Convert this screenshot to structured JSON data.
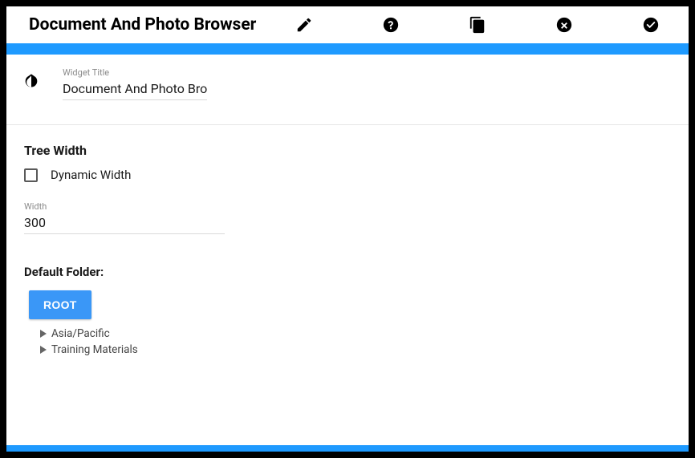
{
  "toolbar": {
    "title": "Document And Photo Browser"
  },
  "widget": {
    "title_label": "Widget Title",
    "title_value": "Document And Photo Browser"
  },
  "tree_width": {
    "heading": "Tree Width",
    "dynamic_label": "Dynamic Width",
    "width_label": "Width",
    "width_value": "300"
  },
  "default_folder": {
    "label": "Default Folder:",
    "root_label": "ROOT",
    "items": [
      "Asia/Pacific",
      "Training Materials"
    ]
  }
}
